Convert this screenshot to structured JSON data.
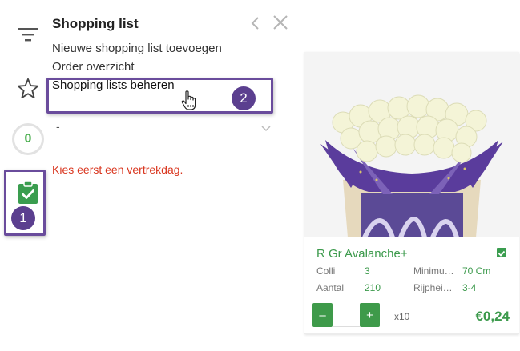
{
  "panel": {
    "title": "Shopping list",
    "menu": [
      "Nieuwe shopping list toevoegen",
      "Order overzicht",
      "Shopping lists beheren"
    ],
    "select_value": "-",
    "warning": "Kies eerst een vertrekdag."
  },
  "rail": {
    "count": "0",
    "icons": [
      "filter-icon",
      "star-icon",
      "clipboard-check-icon"
    ]
  },
  "callouts": {
    "one": "1",
    "two": "2"
  },
  "product": {
    "name": "R Gr Avalanche+",
    "specs": [
      {
        "label": "Colli",
        "value": "3"
      },
      {
        "label": "Minimu…",
        "value": "70 Cm"
      },
      {
        "label": "Aantal",
        "value": "210"
      },
      {
        "label": "Rijphei…",
        "value": "3-4"
      }
    ],
    "qty_minus": "–",
    "qty_plus": "+",
    "qty_value": "",
    "multiplier": "x10",
    "price": "€0,24"
  },
  "colors": {
    "accent_green": "#3c9a4c",
    "callout_purple": "#6a4c9c",
    "warning_red": "#d9361f"
  }
}
